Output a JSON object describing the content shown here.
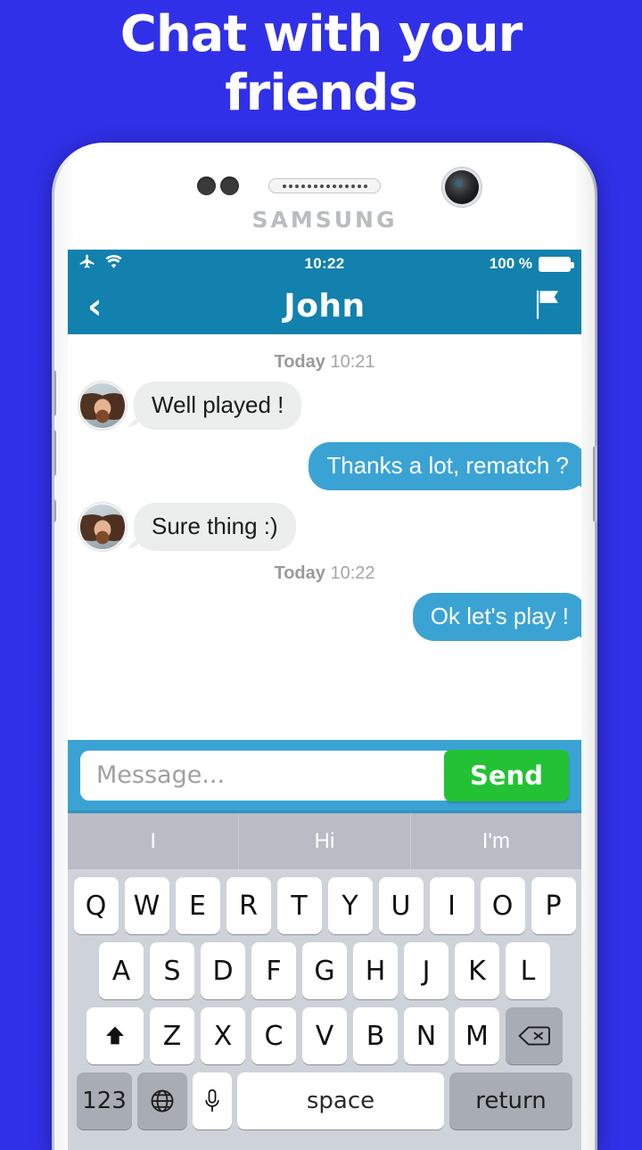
{
  "promo": {
    "headline_line1": "Chat with your",
    "headline_line2": "friends",
    "background_color": "#3030e8"
  },
  "device": {
    "brand": "SAMSUNG",
    "frame_color": "#ffffff"
  },
  "status_bar": {
    "airplane_icon": "airplane-icon",
    "wifi_icon": "wifi-icon",
    "time": "10:22",
    "battery_percent": "100 %",
    "battery_icon": "battery-full-icon",
    "background_color": "#1281ae"
  },
  "nav_bar": {
    "back_icon": "‹",
    "title": "John",
    "flag_icon": "flag-icon",
    "background_color": "#1281ae"
  },
  "chat": {
    "groups": [
      {
        "timestamp_label": "Today",
        "timestamp_time": "10:21",
        "messages": [
          {
            "side": "in",
            "text": "Well played !",
            "avatar": "contact-avatar"
          },
          {
            "side": "out",
            "text": "Thanks a lot, rematch ?"
          },
          {
            "side": "in",
            "text": "Sure thing :)",
            "avatar": "contact-avatar"
          }
        ]
      },
      {
        "timestamp_label": "Today",
        "timestamp_time": "10:22",
        "messages": [
          {
            "side": "out",
            "text": "Ok let's play !"
          }
        ]
      }
    ],
    "incoming_bubble_color": "#eceded",
    "outgoing_bubble_color": "#3ba3d4"
  },
  "composer": {
    "placeholder": "Message...",
    "value": "",
    "send_label": "Send",
    "send_color": "#22c234",
    "bar_color": "#3ba3d4"
  },
  "keyboard": {
    "suggestions": [
      "I",
      "Hi",
      "I'm"
    ],
    "row1": [
      "Q",
      "W",
      "E",
      "R",
      "T",
      "Y",
      "U",
      "I",
      "O",
      "P"
    ],
    "row2": [
      "A",
      "S",
      "D",
      "F",
      "G",
      "H",
      "J",
      "K",
      "L"
    ],
    "row3": [
      "Z",
      "X",
      "C",
      "V",
      "B",
      "N",
      "M"
    ],
    "shift_icon": "⬆",
    "backspace_icon": "⌫",
    "numbers_label": "123",
    "globe_icon": "⊕",
    "mic_icon": "ᵜ",
    "space_label": "space",
    "return_label": "return",
    "background_color": "#ced2d9",
    "suggestion_bar_color": "#b9bcc4"
  }
}
